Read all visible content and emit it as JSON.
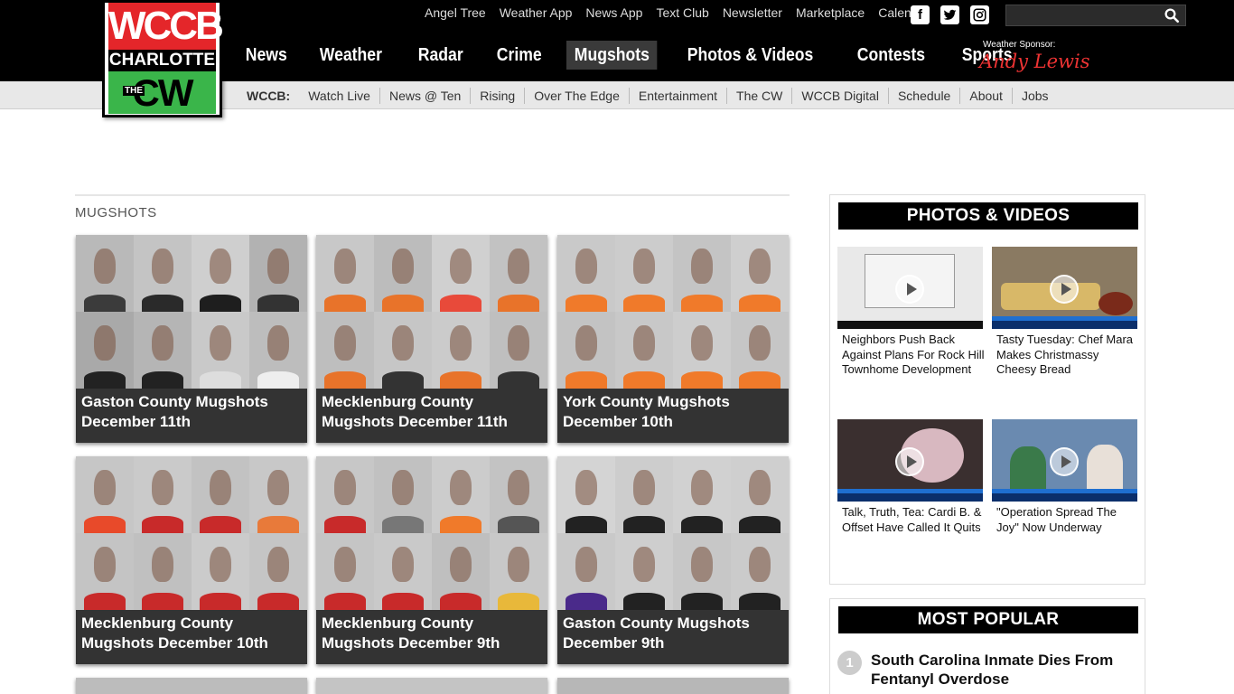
{
  "logo": {
    "top": "WCCB",
    "middle": "CHARLOTTE",
    "the": "THE",
    "bottom": "CW"
  },
  "utility_links": [
    "Angel Tree",
    "Weather App",
    "News App",
    "Text Club",
    "Newsletter",
    "Marketplace",
    "Calendar"
  ],
  "social": [
    "facebook-icon",
    "twitter-icon",
    "instagram-icon"
  ],
  "search": {
    "placeholder": "",
    "value": ""
  },
  "main_nav": [
    "News",
    "Weather",
    "Radar",
    "Crime",
    "Mugshots",
    "Photos & Videos",
    "Contests",
    "Sports"
  ],
  "main_nav_active": "Mugshots",
  "sponsor": {
    "label": "Weather Sponsor:",
    "name": "Andy Lewis"
  },
  "sub_nav": {
    "lead": "WCCB:",
    "items": [
      "Watch Live",
      "News @ Ten",
      "Rising",
      "Over The Edge",
      "Entertainment",
      "The CW",
      "WCCB Digital",
      "Schedule",
      "About",
      "Jobs"
    ]
  },
  "section_title": "MUGSHOTS",
  "cards": [
    {
      "title": "Gaston County Mugshots December 11th"
    },
    {
      "title": "Mecklenburg County Mugshots December 11th"
    },
    {
      "title": "York County Mugshots December 10th"
    },
    {
      "title": "Mecklenburg County Mugshots December 10th"
    },
    {
      "title": "Mecklenburg County Mugshots December 9th"
    },
    {
      "title": "Gaston County Mugshots December 9th"
    }
  ],
  "photos_videos": {
    "heading": "PHOTOS & VIDEOS",
    "items": [
      {
        "title": "Neighbors Push Back Against Plans For Rock Hill Townhome Development"
      },
      {
        "title": "Tasty Tuesday: Chef Mara Makes Christmassy Cheesy Bread"
      },
      {
        "title": "Talk, Truth, Tea: Cardi B. & Offset Have Called It Quits"
      },
      {
        "title": "\"Operation Spread The Joy\" Now Underway"
      }
    ]
  },
  "most_popular": {
    "heading": "MOST POPULAR",
    "items": [
      {
        "rank": "1",
        "title": "South Carolina Inmate Dies From Fentanyl Overdose"
      }
    ]
  },
  "colors": {
    "header_bg": "#000000",
    "subnav_bg": "#e8e8e8",
    "accent_red": "#e4262a",
    "cw_green": "#3ab54a",
    "card_caption_bg": "#333333"
  }
}
